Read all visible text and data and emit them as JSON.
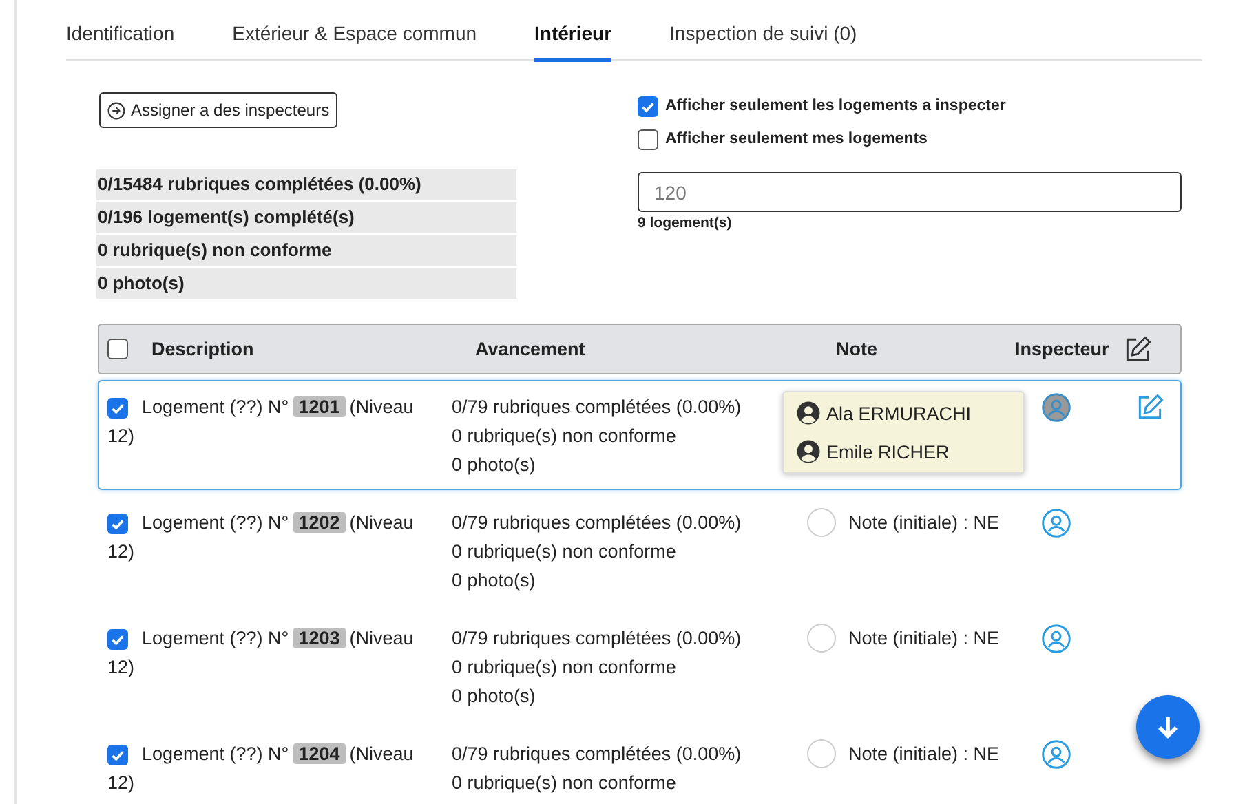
{
  "tabs": [
    {
      "label": "Identification",
      "selected": false
    },
    {
      "label": "Extérieur & Espace commun",
      "selected": false
    },
    {
      "label": "Intérieur",
      "selected": true
    },
    {
      "label": "Inspection de suivi (0)",
      "selected": false
    }
  ],
  "assign_button": "Assigner a des inspecteurs",
  "filters": [
    {
      "label": "Afficher seulement les logements a inspecter",
      "checked": true
    },
    {
      "label": "Afficher seulement mes logements",
      "checked": false
    }
  ],
  "stats": [
    "0/15484 rubriques complétées (0.00%)",
    "0/196 logement(s) complété(s)",
    "0 rubrique(s) non conforme",
    "0 photo(s)"
  ],
  "search": {
    "value": "120",
    "count": "9 logement(s)"
  },
  "table": {
    "all_checked": false,
    "columns": [
      "Description",
      "Avancement",
      "Note",
      "Inspecteur"
    ],
    "rows": [
      {
        "selected": true,
        "checked": true,
        "label": "Logement (??) N°",
        "unit": "1201",
        "level_text": [
          "(Niveau",
          "12)"
        ],
        "progress": [
          "0/79 rubriques complétées (0.00%)",
          "0 rubrique(s) non conforme",
          "0 photo(s)"
        ],
        "inspectors": [
          "Ala ERMURACHI",
          "Emile RICHER"
        ]
      },
      {
        "selected": false,
        "checked": true,
        "label": "Logement (??) N°",
        "unit": "1202",
        "level_text": [
          "(Niveau",
          "12)"
        ],
        "progress": [
          "0/79 rubriques complétées (0.00%)",
          "0 rubrique(s) non conforme",
          "0 photo(s)"
        ],
        "note": "Note (initiale) : NE"
      },
      {
        "selected": false,
        "checked": true,
        "label": "Logement (??) N°",
        "unit": "1203",
        "level_text": [
          "(Niveau",
          "12)"
        ],
        "progress": [
          "0/79 rubriques complétées (0.00%)",
          "0 rubrique(s) non conforme",
          "0 photo(s)"
        ],
        "note": "Note (initiale) : NE"
      },
      {
        "selected": false,
        "checked": true,
        "label": "Logement (??) N°",
        "unit": "1204",
        "level_text": [
          "(Niveau",
          "12)"
        ],
        "progress": [
          "0/79 rubriques complétées (0.00%)",
          "0 rubrique(s) non conforme"
        ],
        "note": "Note (initiale) : NE"
      }
    ]
  }
}
